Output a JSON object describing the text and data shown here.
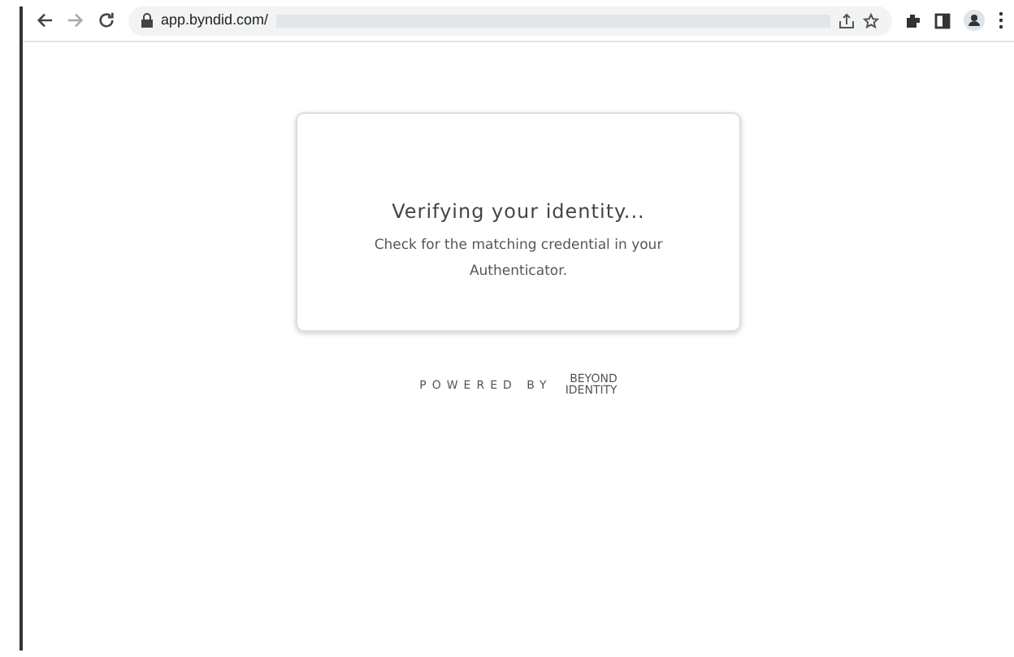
{
  "browser": {
    "url": "app.byndid.com/"
  },
  "card": {
    "title": "Verifying your identity...",
    "message": "Check for the matching credential in your Authenticator."
  },
  "footer": {
    "powered_by": "POWERED BY",
    "logo_lines": [
      "BEYOND",
      "IDENTITY"
    ]
  }
}
